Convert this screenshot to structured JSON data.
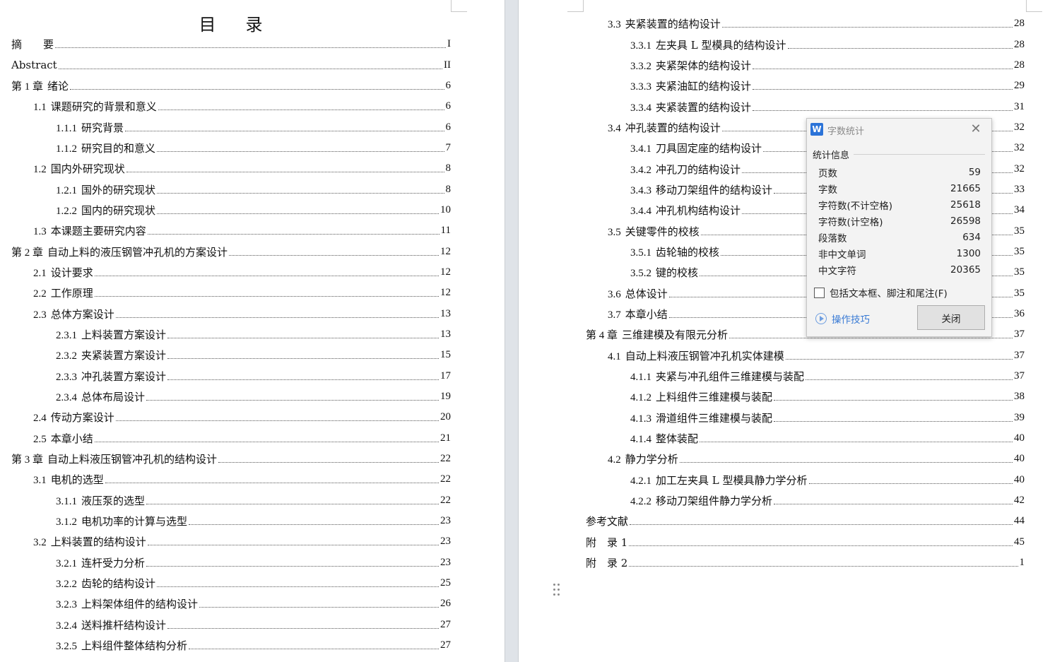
{
  "left_page": {
    "title_chars": [
      "目",
      "录"
    ],
    "entries": [
      {
        "level": 1,
        "num": "",
        "text": "摘　　要",
        "page": "I"
      },
      {
        "level": 1,
        "num": "",
        "text": "Abstract",
        "page": "II"
      },
      {
        "level": 1,
        "num": "第 1 章",
        "text": "绪论",
        "page": "6"
      },
      {
        "level": 2,
        "num": "1.1",
        "text": "课题研究的背景和意义",
        "page": "6"
      },
      {
        "level": 3,
        "num": "1.1.1",
        "text": "研究背景",
        "page": "6"
      },
      {
        "level": 3,
        "num": "1.1.2",
        "text": "研究目的和意义",
        "page": "7"
      },
      {
        "level": 2,
        "num": "1.2",
        "text": "国内外研究现状",
        "page": "8"
      },
      {
        "level": 3,
        "num": "1.2.1",
        "text": "国外的研究现状",
        "page": "8"
      },
      {
        "level": 3,
        "num": "1.2.2",
        "text": "国内的研究现状",
        "page": "10"
      },
      {
        "level": 2,
        "num": "1.3",
        "text": "本课题主要研究内容",
        "page": "11"
      },
      {
        "level": 1,
        "num": "第 2 章",
        "text": "自动上料的液压钢管冲孔机的方案设计",
        "page": "12"
      },
      {
        "level": 2,
        "num": "2.1",
        "text": "设计要求",
        "page": "12"
      },
      {
        "level": 2,
        "num": "2.2",
        "text": "工作原理",
        "page": "12"
      },
      {
        "level": 2,
        "num": "2.3",
        "text": "总体方案设计",
        "page": "13"
      },
      {
        "level": 3,
        "num": "2.3.1",
        "text": "上料装置方案设计",
        "page": "13"
      },
      {
        "level": 3,
        "num": "2.3.2",
        "text": "夹紧装置方案设计",
        "page": "15"
      },
      {
        "level": 3,
        "num": "2.3.3",
        "text": "冲孔装置方案设计",
        "page": "17"
      },
      {
        "level": 3,
        "num": "2.3.4",
        "text": "总体布局设计",
        "page": "19"
      },
      {
        "level": 2,
        "num": "2.4",
        "text": "传动方案设计",
        "page": "20"
      },
      {
        "level": 2,
        "num": "2.5",
        "text": "本章小结",
        "page": "21"
      },
      {
        "level": 1,
        "num": "第 3 章",
        "text": "自动上料液压钢管冲孔机的结构设计",
        "page": "22"
      },
      {
        "level": 2,
        "num": "3.1",
        "text": "电机的选型",
        "page": "22"
      },
      {
        "level": 3,
        "num": "3.1.1",
        "text": "液压泵的选型",
        "page": "22"
      },
      {
        "level": 3,
        "num": "3.1.2",
        "text": "电机功率的计算与选型",
        "page": "23"
      },
      {
        "level": 2,
        "num": "3.2",
        "text": "上料装置的结构设计",
        "page": "23"
      },
      {
        "level": 3,
        "num": "3.2.1",
        "text": "连杆受力分析",
        "page": "23"
      },
      {
        "level": 3,
        "num": "3.2.2",
        "text": "齿轮的结构设计",
        "page": "25"
      },
      {
        "level": 3,
        "num": "3.2.3",
        "text": "上料架体组件的结构设计",
        "page": "26"
      },
      {
        "level": 3,
        "num": "3.2.4",
        "text": "送料推杆结构设计",
        "page": "27"
      },
      {
        "level": 3,
        "num": "3.2.5",
        "text": "上料组件整体结构分析",
        "page": "27"
      }
    ]
  },
  "right_page": {
    "entries": [
      {
        "level": 2,
        "num": "3.3",
        "text": "夹紧装置的结构设计",
        "page": "28"
      },
      {
        "level": 3,
        "num": "3.3.1",
        "text": "左夹具 L 型模具的结构设计",
        "page": "28"
      },
      {
        "level": 3,
        "num": "3.3.2",
        "text": "夹紧架体的结构设计",
        "page": "28"
      },
      {
        "level": 3,
        "num": "3.3.3",
        "text": "夹紧油缸的结构设计",
        "page": "29"
      },
      {
        "level": 3,
        "num": "3.3.4",
        "text": "夹紧装置的结构设计",
        "page": "31"
      },
      {
        "level": 2,
        "num": "3.4",
        "text": "冲孔装置的结构设计",
        "page": "32"
      },
      {
        "level": 3,
        "num": "3.4.1",
        "text": "刀具固定座的结构设计",
        "page": "32"
      },
      {
        "level": 3,
        "num": "3.4.2",
        "text": "冲孔刀的结构设计",
        "page": "32"
      },
      {
        "level": 3,
        "num": "3.4.3",
        "text": "移动刀架组件的结构设计",
        "page": "33"
      },
      {
        "level": 3,
        "num": "3.4.4",
        "text": "冲孔机构结构设计",
        "page": "34"
      },
      {
        "level": 2,
        "num": "3.5",
        "text": "关键零件的校核",
        "page": "35"
      },
      {
        "level": 3,
        "num": "3.5.1",
        "text": "齿轮轴的校核",
        "page": "35"
      },
      {
        "level": 3,
        "num": "3.5.2",
        "text": "键的校核",
        "page": "35"
      },
      {
        "level": 2,
        "num": "3.6",
        "text": "总体设计",
        "page": "35"
      },
      {
        "level": 2,
        "num": "3.7",
        "text": "本章小结",
        "page": "36"
      },
      {
        "level": 1,
        "num": "第 4 章",
        "text": "三维建模及有限元分析",
        "page": "37"
      },
      {
        "level": 2,
        "num": "4.1",
        "text": "自动上料液压钢管冲孔机实体建模",
        "page": "37"
      },
      {
        "level": 3,
        "num": "4.1.1",
        "text": "夹紧与冲孔组件三维建模与装配",
        "page": "37"
      },
      {
        "level": 3,
        "num": "4.1.2",
        "text": "上料组件三维建模与装配",
        "page": "38"
      },
      {
        "level": 3,
        "num": "4.1.3",
        "text": "滑道组件三维建模与装配",
        "page": "39"
      },
      {
        "level": 3,
        "num": "4.1.4",
        "text": "整体装配",
        "page": "40"
      },
      {
        "level": 2,
        "num": "4.2",
        "text": "静力学分析",
        "page": "40"
      },
      {
        "level": 3,
        "num": "4.2.1",
        "text": "加工左夹具 L 型模具静力学分析",
        "page": "40"
      },
      {
        "level": 3,
        "num": "4.2.2",
        "text": "移动刀架组件静力学分析",
        "page": "42"
      },
      {
        "level": 1,
        "num": "",
        "text": "参考文献",
        "page": "44"
      },
      {
        "level": 1,
        "num": "",
        "text": "附　录 1",
        "page": "45"
      },
      {
        "level": 1,
        "num": "",
        "text": "附　录 2",
        "page": "1"
      }
    ]
  },
  "dialog": {
    "logo_letter": "W",
    "title": "字数统计",
    "close_glyph": "✕",
    "group_label": "统计信息",
    "stats": [
      {
        "label": "页数",
        "value": "59"
      },
      {
        "label": "字数",
        "value": "21665"
      },
      {
        "label": "字符数(不计空格)",
        "value": "25618"
      },
      {
        "label": "字符数(计空格)",
        "value": "26598"
      },
      {
        "label": "段落数",
        "value": "634"
      },
      {
        "label": "非中文单词",
        "value": "1300"
      },
      {
        "label": "中文字符",
        "value": "20365"
      }
    ],
    "checkbox_label": "包括文本框、脚注和尾注(F)",
    "checkbox_checked": false,
    "tips_label": "操作技巧",
    "close_button_label": "关闭"
  },
  "colors": {
    "link": "#3a7bd5",
    "logo": "#2b73d8",
    "gutter": "#dfe3e8"
  }
}
